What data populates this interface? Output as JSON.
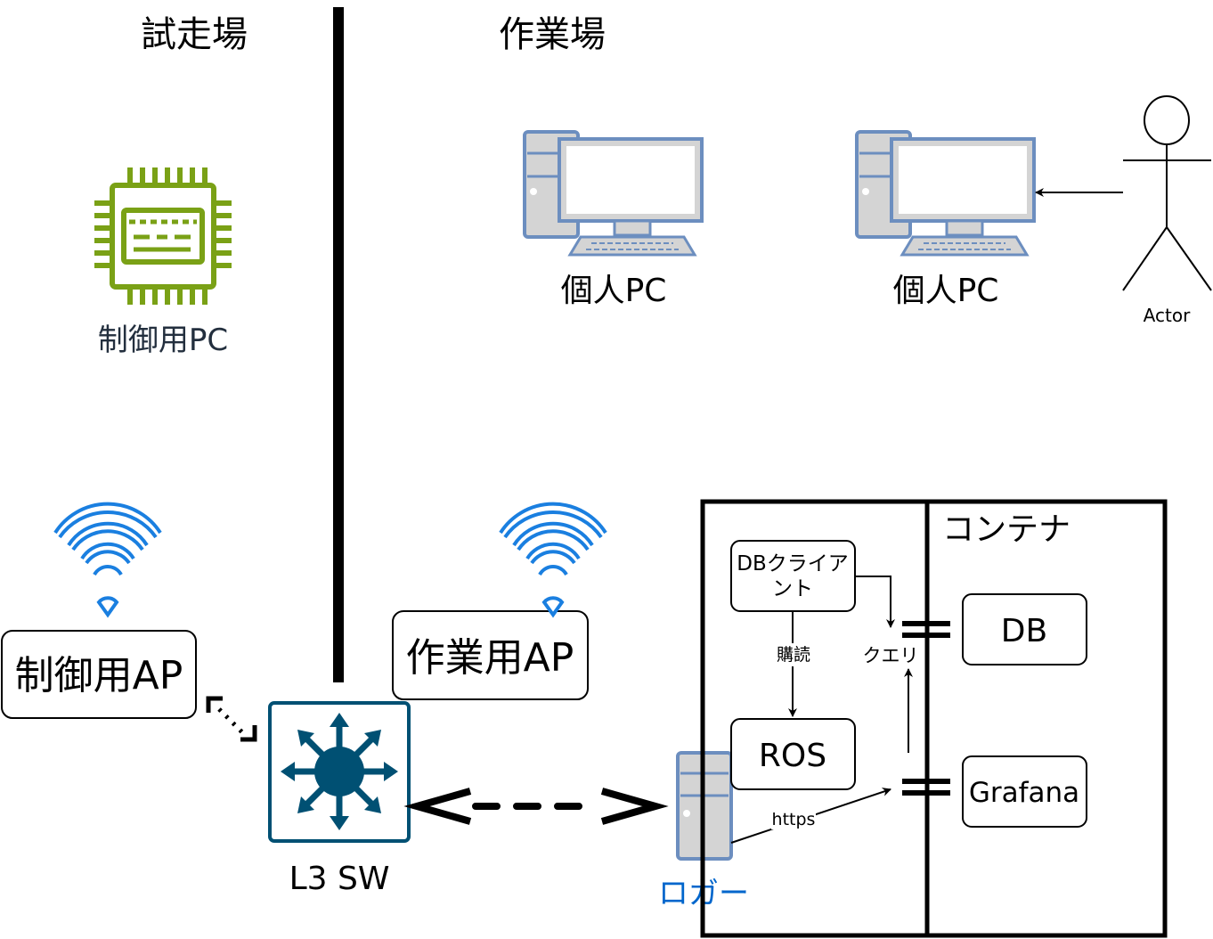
{
  "zones": {
    "left_title": "試走場",
    "right_title": "作業場"
  },
  "nodes": {
    "control_pc": {
      "label": "制御用PC",
      "icon": "microchip-icon",
      "color": "#7AA116"
    },
    "personal_pc_1": {
      "label": "個人PC",
      "icon": "desktop-computer-icon"
    },
    "personal_pc_2": {
      "label": "個人PC",
      "icon": "desktop-computer-icon"
    },
    "actor": {
      "label": "Actor",
      "icon": "stick-figure-icon"
    },
    "control_ap": {
      "label": "制御用AP",
      "icon": "wifi-icon"
    },
    "work_ap": {
      "label": "作業用AP",
      "icon": "wifi-icon"
    },
    "l3_switch": {
      "label": "L3 SW",
      "icon": "network-switch-icon",
      "color": "#005073"
    },
    "logger": {
      "label": "ロガー",
      "icon": "server-tower-icon",
      "color": "#0066CC"
    },
    "container": {
      "label": "コンテナ"
    },
    "db_client": {
      "label_line1": "DBクライア",
      "label_line2": "ント"
    },
    "ros": {
      "label": "ROS"
    },
    "db": {
      "label": "DB"
    },
    "grafana": {
      "label": "Grafana"
    }
  },
  "edges": {
    "subscribe": "購読",
    "query": "クエリ",
    "https": "https"
  },
  "colors": {
    "wifi": "#1A7FE0",
    "monitor_frame": "#6C8EBF",
    "monitor_fill": "#D4D4D4",
    "chip": "#7AA116",
    "switch": "#005073"
  }
}
